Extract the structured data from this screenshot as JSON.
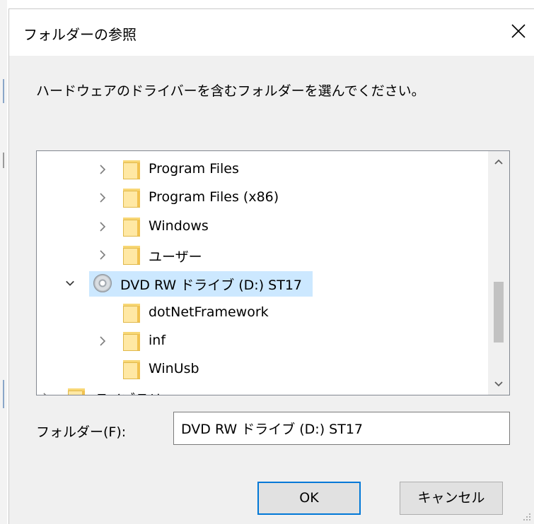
{
  "dialog": {
    "title": "フォルダーの参照",
    "instruction": "ハードウェアのドライバーを含むフォルダーを選んでください。",
    "close_icon": "close-icon"
  },
  "tree": {
    "items": [
      {
        "label": "Program Files",
        "icon": "folder-icon",
        "expander": "chevron-right-icon"
      },
      {
        "label": "Program Files (x86)",
        "icon": "folder-icon",
        "expander": "chevron-right-icon"
      },
      {
        "label": "Windows",
        "icon": "folder-icon",
        "expander": "chevron-right-icon"
      },
      {
        "label": "ユーザー",
        "icon": "folder-icon",
        "expander": "chevron-right-icon"
      },
      {
        "label": "DVD RW ドライブ (D:) ST17",
        "icon": "dvd-drive-icon",
        "expander": "chevron-down-icon",
        "selected": true
      },
      {
        "label": "dotNetFramework",
        "icon": "folder-icon",
        "expander": ""
      },
      {
        "label": "inf",
        "icon": "folder-icon",
        "expander": "chevron-right-icon"
      },
      {
        "label": "WinUsb",
        "icon": "folder-icon",
        "expander": ""
      },
      {
        "label": "ライブラリ",
        "icon": "library-icon",
        "expander": "chevron-right-icon"
      }
    ]
  },
  "folder_field": {
    "label": "フォルダー(F):",
    "value": "DVD RW ドライブ (D:) ST17"
  },
  "buttons": {
    "ok": "OK",
    "cancel": "キャンセル"
  },
  "colors": {
    "selection": "#cce8ff",
    "focus_border": "#0078d7",
    "dialog_bg": "#f0f0f0"
  }
}
